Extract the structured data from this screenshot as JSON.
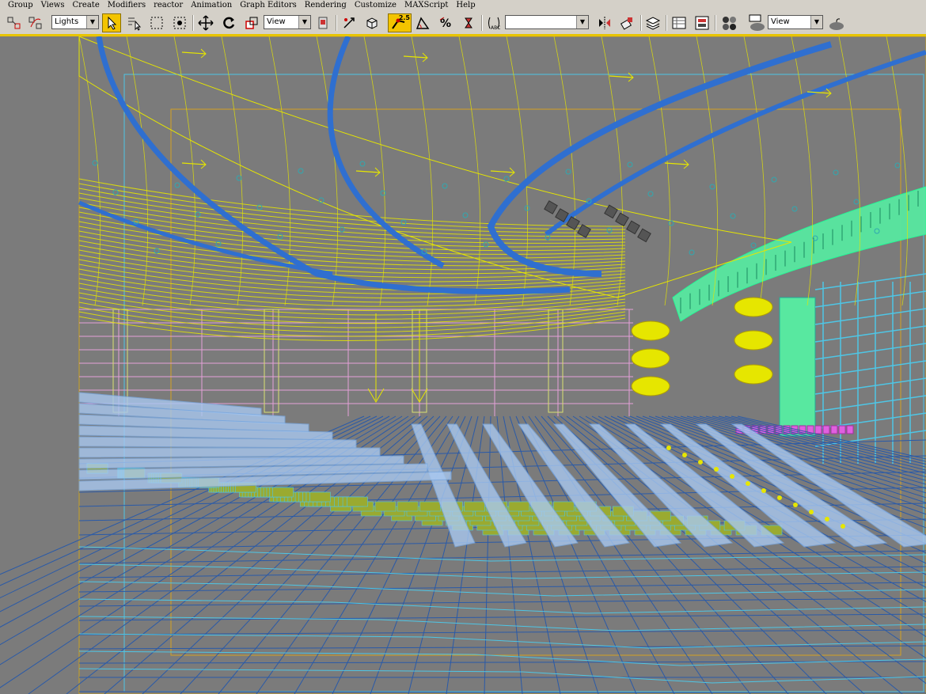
{
  "menu": {
    "items": [
      "Group",
      "Views",
      "Create",
      "Modifiers",
      "reactor",
      "Animation",
      "Graph Editors",
      "Rendering",
      "Customize",
      "MAXScript",
      "Help"
    ]
  },
  "toolbar": {
    "selection_filter": "Lights",
    "reference_coord": "View",
    "spinner_snap": "2.5",
    "named_selection": "",
    "render_view": "View"
  },
  "colors": {
    "ui_gray": "#d4d0c8",
    "active_yellow": "#f3c400",
    "viewport_bg": "#7b7b7b",
    "wire_yellow": "#e6e600",
    "wire_blue": "#2f6fd0",
    "wire_cyan": "#4ec6e6",
    "wire_pink": "#e4a0d8",
    "wire_green": "#58e8a0",
    "safe_frame": "#d4a020"
  },
  "icons": [
    "select-link-icon",
    "unlink-icon",
    "select-object-icon",
    "select-by-name-icon",
    "rectangular-region-icon",
    "window-crossing-icon",
    "move-icon",
    "rotate-icon",
    "scale-icon",
    "use-pivot-icon",
    "manipulate-icon",
    "snap-3d-icon",
    "angle-snap-icon",
    "percent-snap-icon",
    "spinner-snap-icon",
    "edit-named-selection-icon",
    "mirror-icon",
    "align-icon",
    "layer-manager-icon",
    "curve-editor-icon",
    "schematic-view-icon",
    "material-editor-icon",
    "render-scene-icon",
    "quick-render-icon"
  ]
}
